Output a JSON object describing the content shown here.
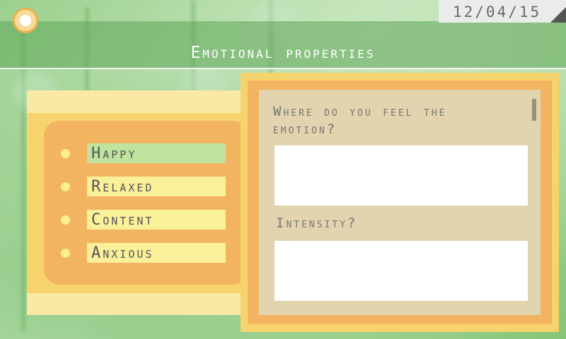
{
  "header": {
    "date": "12/04/15",
    "title": "Emotional properties"
  },
  "options": [
    {
      "label": "Happy",
      "selected": true
    },
    {
      "label": "Relaxed",
      "selected": false
    },
    {
      "label": "Content",
      "selected": false
    },
    {
      "label": "Anxious",
      "selected": false
    }
  ],
  "form": {
    "question_location": "Where do you feel the emotion?",
    "location_value": "",
    "question_intensity": "Intensity?",
    "intensity_value": ""
  },
  "colors": {
    "selected_option": "#c0e3a0",
    "option_label": "#fbf09a",
    "panel_orange": "#f2b461",
    "panel_yellow": "#f7d36d",
    "form_background": "#e2d4ae"
  }
}
